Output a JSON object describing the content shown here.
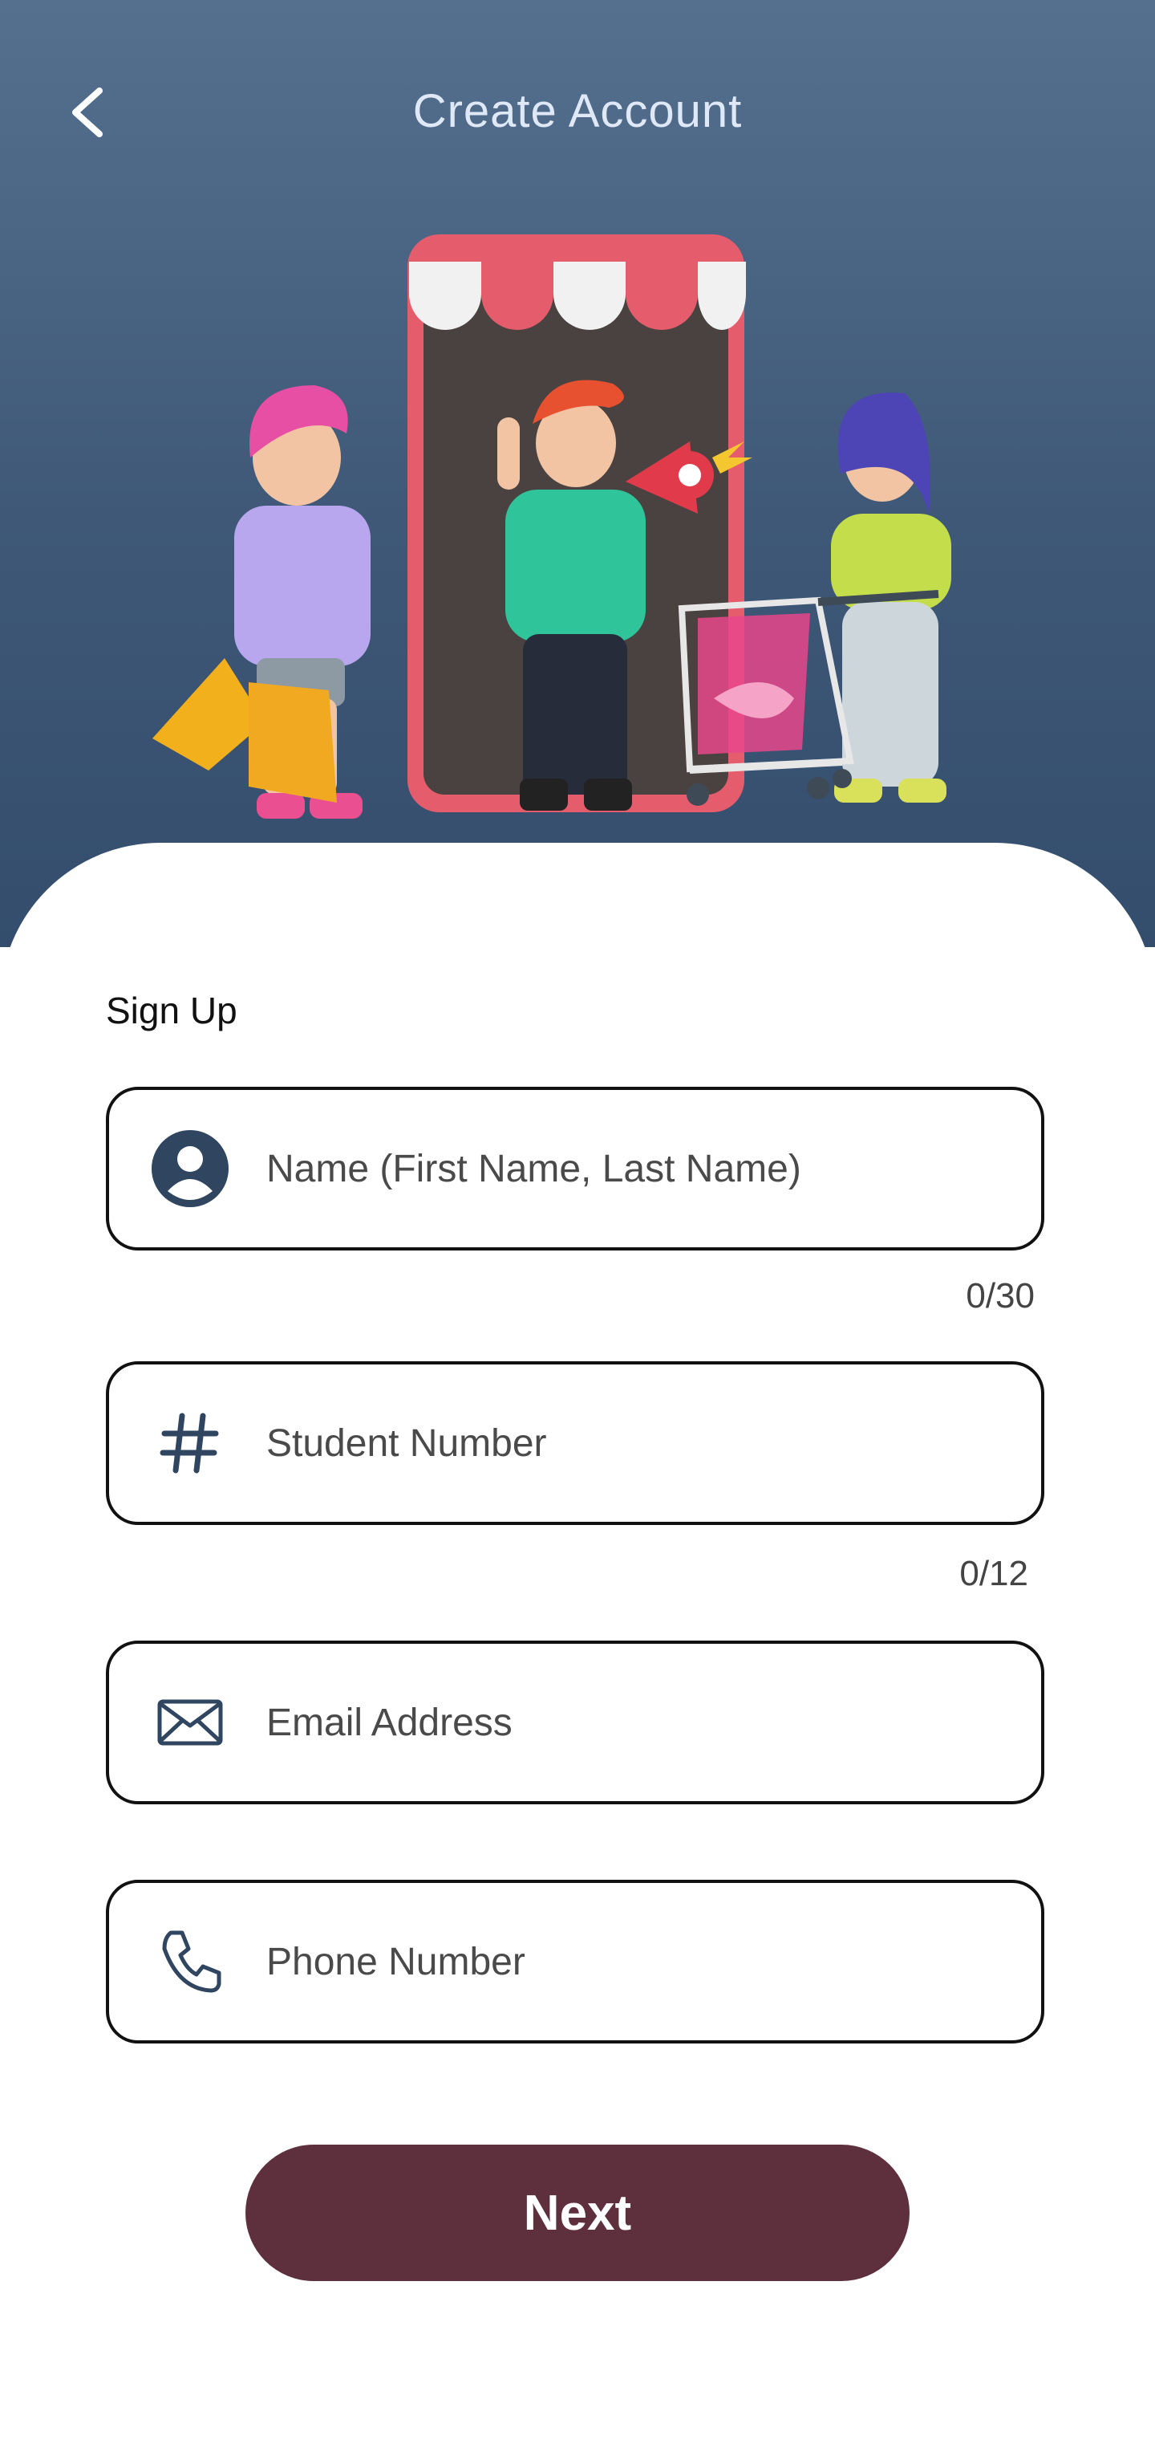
{
  "header": {
    "title": "Create Account",
    "back_icon": "chevron-left-icon"
  },
  "form": {
    "section_label": "Sign Up",
    "name": {
      "placeholder": "Name (First Name, Last Name)",
      "value": "",
      "icon": "user-avatar-icon",
      "counter": "0/30"
    },
    "student_number": {
      "placeholder": "Student Number",
      "value": "",
      "icon": "hash-icon",
      "counter": "0/12"
    },
    "email": {
      "placeholder": "Email Address",
      "value": "",
      "icon": "envelope-icon"
    },
    "phone": {
      "placeholder": "Phone Number",
      "value": "",
      "icon": "phone-icon"
    }
  },
  "actions": {
    "next_label": "Next"
  },
  "colors": {
    "header_top": "#55708f",
    "header_bottom": "#344d6d",
    "title_text": "#dfe8f6",
    "primary_button": "#5e2f3c",
    "field_border": "#111111",
    "icon_color": "#2f4560"
  }
}
